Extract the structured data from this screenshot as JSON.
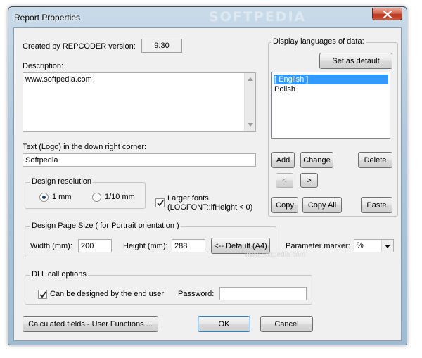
{
  "window": {
    "title": "Report Properties",
    "watermark": "SOFTPEDIA"
  },
  "version": {
    "label": "Created by REPCODER version:",
    "value": "9.30"
  },
  "description": {
    "label": "Description:",
    "value": "www.softpedia.com"
  },
  "logo": {
    "label": "Text (Logo) in the down right corner:",
    "value": "Softpedia"
  },
  "design_resolution": {
    "title": "Design resolution",
    "options": [
      "1 mm",
      "1/10 mm"
    ],
    "selected": "1 mm"
  },
  "larger_fonts": {
    "label_line1": "Larger fonts",
    "label_line2": "(LOGFONT::lfHeight < 0)",
    "checked": true
  },
  "page_size": {
    "title": "Design Page Size ( for Portrait orientation )",
    "width_label": "Width (mm):",
    "width_value": "200",
    "height_label": "Height (mm):",
    "height_value": "288",
    "default_button": "<-- Default (A4)"
  },
  "parameter_marker": {
    "label": "Parameter marker:",
    "value": "%"
  },
  "dll": {
    "title": "DLL call options",
    "checkbox_label": "Can be designed by the end user",
    "checked": true,
    "password_label": "Password:",
    "password_value": ""
  },
  "languages": {
    "title": "Display languages of data:",
    "set_default": "Set as default",
    "items": [
      "[ English ]",
      "Polish"
    ],
    "selected_index": 0,
    "add": "Add",
    "change": "Change",
    "delete": "Delete",
    "prev": "<",
    "next": ">",
    "copy": "Copy",
    "copy_all": "Copy All",
    "paste": "Paste"
  },
  "footer": {
    "calc_fields": "Calculated fields - User Functions ...",
    "ok": "OK",
    "cancel": "Cancel"
  },
  "watermark_bottom": "www.softpedia.com"
}
